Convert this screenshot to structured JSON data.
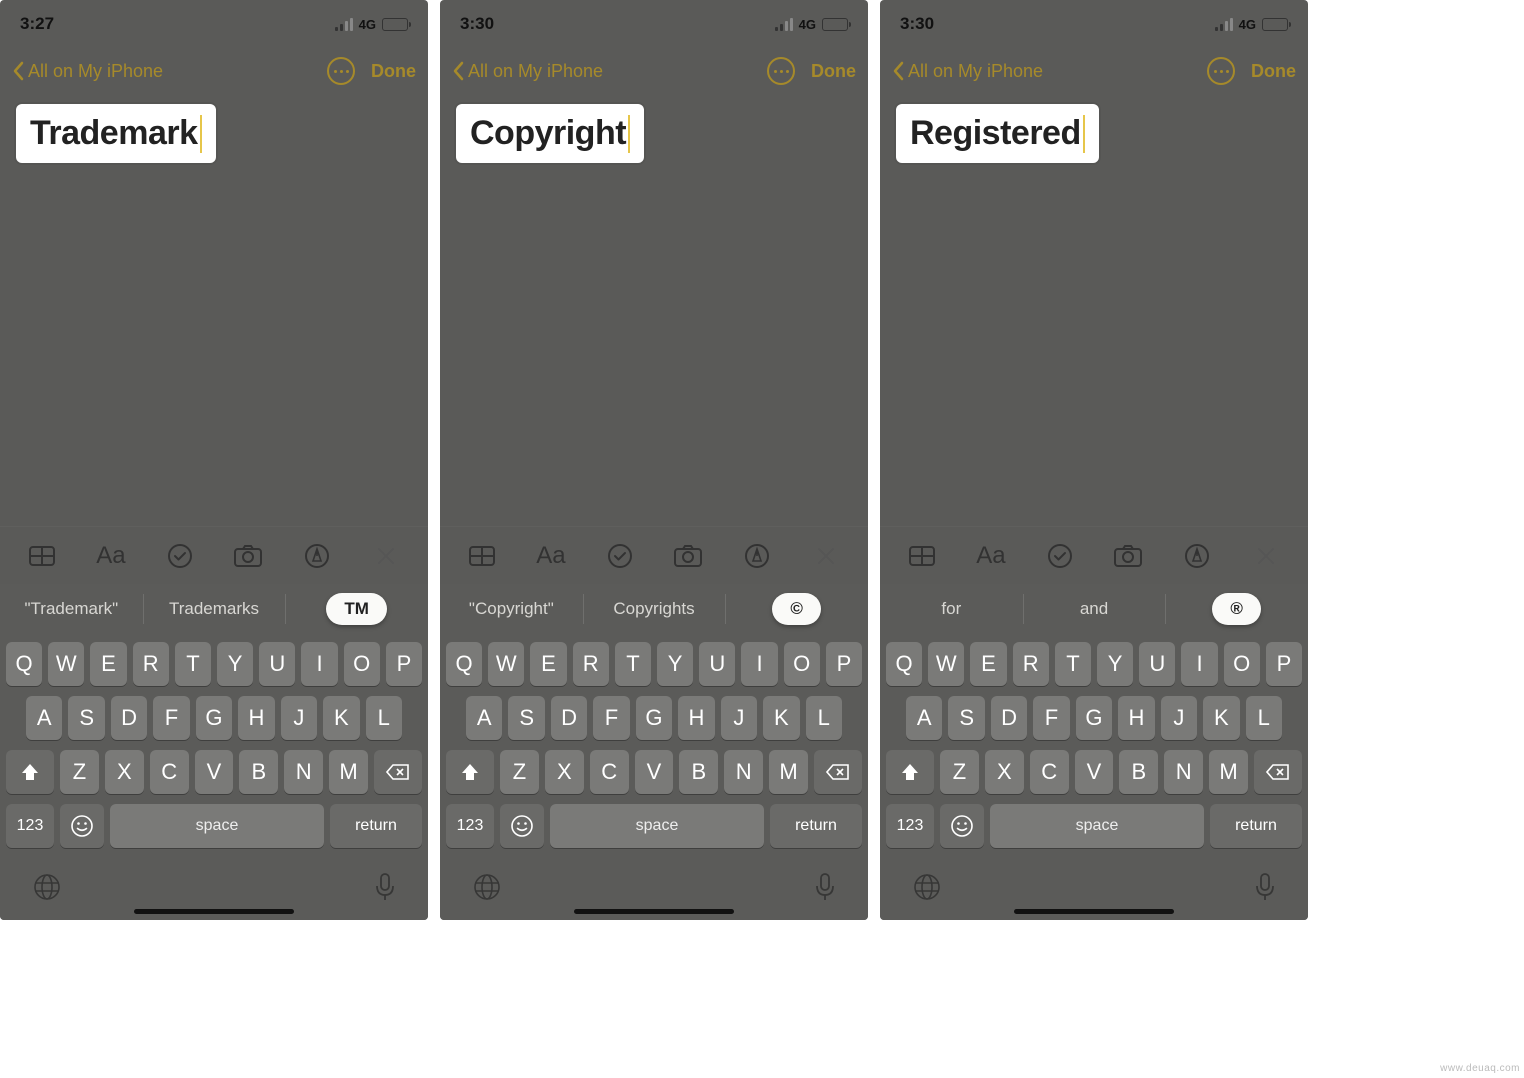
{
  "screens": [
    {
      "status": {
        "time": "3:27",
        "network": "4G"
      },
      "nav": {
        "back_label": "All on My iPhone",
        "done_label": "Done"
      },
      "note": {
        "typed_text": "Trademark"
      },
      "predictions": {
        "left": "\"Trademark\"",
        "middle": "Trademarks",
        "right_symbol": "TM"
      },
      "keyboard": {
        "row1": [
          "Q",
          "W",
          "E",
          "R",
          "T",
          "Y",
          "U",
          "I",
          "O",
          "P"
        ],
        "row2": [
          "A",
          "S",
          "D",
          "F",
          "G",
          "H",
          "J",
          "K",
          "L"
        ],
        "row3": [
          "Z",
          "X",
          "C",
          "V",
          "B",
          "N",
          "M"
        ],
        "numbers_label": "123",
        "space_label": "space",
        "return_label": "return"
      }
    },
    {
      "status": {
        "time": "3:30",
        "network": "4G"
      },
      "nav": {
        "back_label": "All on My iPhone",
        "done_label": "Done"
      },
      "note": {
        "typed_text": "Copyright"
      },
      "predictions": {
        "left": "\"Copyright\"",
        "middle": "Copyrights",
        "right_symbol": "©"
      },
      "keyboard": {
        "row1": [
          "Q",
          "W",
          "E",
          "R",
          "T",
          "Y",
          "U",
          "I",
          "O",
          "P"
        ],
        "row2": [
          "A",
          "S",
          "D",
          "F",
          "G",
          "H",
          "J",
          "K",
          "L"
        ],
        "row3": [
          "Z",
          "X",
          "C",
          "V",
          "B",
          "N",
          "M"
        ],
        "numbers_label": "123",
        "space_label": "space",
        "return_label": "return"
      }
    },
    {
      "status": {
        "time": "3:30",
        "network": "4G"
      },
      "nav": {
        "back_label": "All on My iPhone",
        "done_label": "Done"
      },
      "note": {
        "typed_text": "Registered"
      },
      "predictions": {
        "left": "for",
        "middle": "and",
        "right_symbol": "®"
      },
      "keyboard": {
        "row1": [
          "Q",
          "W",
          "E",
          "R",
          "T",
          "Y",
          "U",
          "I",
          "O",
          "P"
        ],
        "row2": [
          "A",
          "S",
          "D",
          "F",
          "G",
          "H",
          "J",
          "K",
          "L"
        ],
        "row3": [
          "Z",
          "X",
          "C",
          "V",
          "B",
          "N",
          "M"
        ],
        "numbers_label": "123",
        "space_label": "space",
        "return_label": "return"
      }
    }
  ],
  "watermark": "www.deuaq.com"
}
